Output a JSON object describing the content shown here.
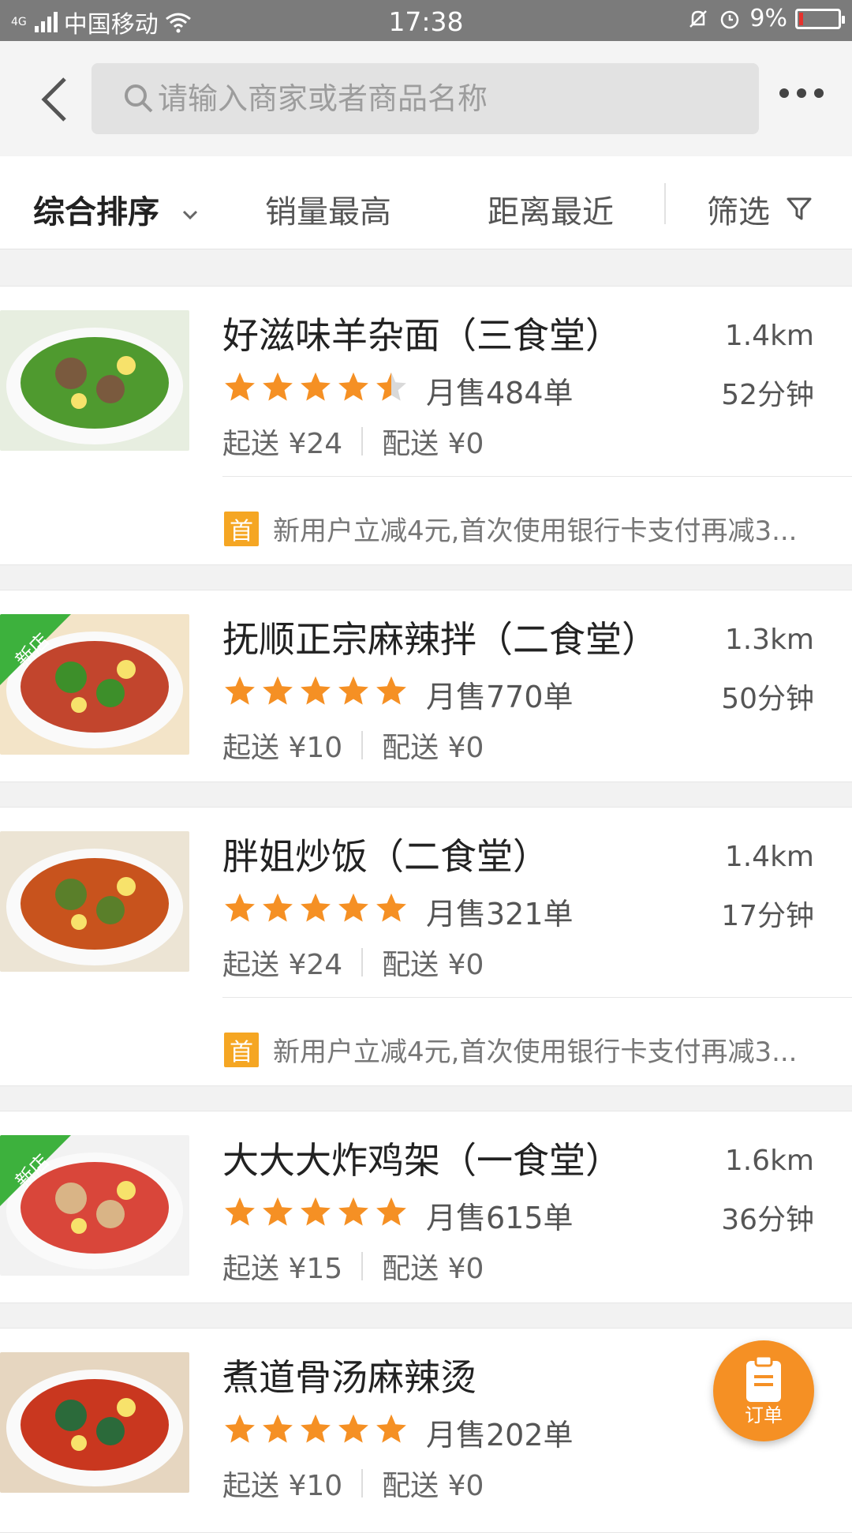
{
  "status_bar": {
    "network": "4G",
    "carrier": "中国移动",
    "time": "17:38",
    "battery": "9%",
    "battery_level": 0.09
  },
  "search": {
    "placeholder": "请输入商家或者商品名称"
  },
  "sort_bar": {
    "items": [
      "综合排序",
      "销量最高",
      "距离最近",
      "筛选"
    ],
    "active_index": 0
  },
  "shops": [
    {
      "name": "好滋味羊杂面（三食堂）",
      "distance": "1.4km",
      "time": "52分钟",
      "rating": 4.5,
      "sales": "月售484单",
      "min_order": "起送 ¥24",
      "delivery_fee": "配送 ¥0",
      "new": false,
      "promo_badge": "首",
      "promo": "新用户立减4元,首次使用银行卡支付再减3..."
    },
    {
      "name": "抚顺正宗麻辣拌（二食堂）",
      "distance": "1.3km",
      "time": "50分钟",
      "rating": 5,
      "sales": "月售770单",
      "min_order": "起送 ¥10",
      "delivery_fee": "配送 ¥0",
      "new": true,
      "new_label": "新店"
    },
    {
      "name": "胖姐炒饭（二食堂）",
      "distance": "1.4km",
      "time": "17分钟",
      "rating": 5,
      "sales": "月售321单",
      "min_order": "起送 ¥24",
      "delivery_fee": "配送 ¥0",
      "new": false,
      "promo_badge": "首",
      "promo": "新用户立减4元,首次使用银行卡支付再减3..."
    },
    {
      "name": "大大大炸鸡架（一食堂）",
      "distance": "1.6km",
      "time": "36分钟",
      "rating": 5,
      "sales": "月售615单",
      "min_order": "起送 ¥15",
      "delivery_fee": "配送 ¥0",
      "new": true,
      "new_label": "新店"
    },
    {
      "name": "煮道骨汤麻辣烫",
      "distance": "",
      "time": "",
      "rating": 5,
      "sales": "月售202单",
      "min_order": "起送 ¥10",
      "delivery_fee": "配送 ¥0",
      "new": false
    }
  ],
  "fab": {
    "label": "订单",
    "icon": "clipboard-icon",
    "color": "#f59024"
  },
  "colors": {
    "star": "#f59024",
    "badge": "#f5a623",
    "new_tag": "#3db13d"
  }
}
